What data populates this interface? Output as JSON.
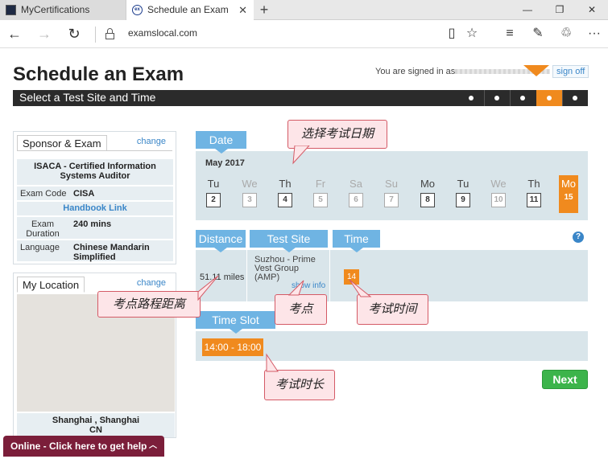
{
  "browser": {
    "tabs": [
      {
        "label": "MyCertifications"
      },
      {
        "label": "Schedule an Exam"
      }
    ],
    "url": "examslocal.com"
  },
  "page": {
    "title": "Schedule an Exam",
    "signed_in_text": "You are signed in as",
    "sign_off": "sign off",
    "step_title": "Select a Test Site and Time",
    "step_count": 5,
    "active_step": 4
  },
  "sponsor": {
    "heading": "Sponsor & Exam",
    "change": "change",
    "exam_name": "ISACA - Certified Information Systems Auditor",
    "exam_code_label": "Exam Code",
    "exam_code": "CISA",
    "handbook": "Handbook Link",
    "duration_label": "Exam Duration",
    "duration": "240 mins",
    "language_label": "Language",
    "language": "Chinese Mandarin Simplified"
  },
  "location": {
    "heading": "My Location",
    "change": "change",
    "city": "Shanghai , Shanghai",
    "country": "CN"
  },
  "date": {
    "label": "Date",
    "month": "May 2017",
    "days": [
      {
        "name": "Tu",
        "num": "2",
        "available": true
      },
      {
        "name": "We",
        "num": "3",
        "available": false
      },
      {
        "name": "Th",
        "num": "4",
        "available": true
      },
      {
        "name": "Fr",
        "num": "5",
        "available": false
      },
      {
        "name": "Sa",
        "num": "6",
        "available": false
      },
      {
        "name": "Su",
        "num": "7",
        "available": false
      },
      {
        "name": "Mo",
        "num": "8",
        "available": true
      },
      {
        "name": "Tu",
        "num": "9",
        "available": true
      },
      {
        "name": "We",
        "num": "10",
        "available": false
      },
      {
        "name": "Th",
        "num": "11",
        "available": true
      },
      {
        "name": "Mo",
        "num": "15",
        "available": true,
        "selected": true
      }
    ]
  },
  "distance": {
    "label": "Distance",
    "value": "51.11 miles"
  },
  "test_site": {
    "label": "Test Site",
    "name": "Suzhou - Prime Vest Group (AMP)",
    "show_info": "show info"
  },
  "time": {
    "label": "Time",
    "value": "14"
  },
  "time_slot": {
    "label": "Time Slot",
    "value": "14:00 - 18:00"
  },
  "next": "Next",
  "help": "?",
  "chat": {
    "label": "Online - Click here to get help"
  },
  "annotations": {
    "date": "选择考试日期",
    "distance": "考点路程距离",
    "site": "考点",
    "time": "考试时间",
    "duration": "考试时长"
  },
  "colors": {
    "accent_orange": "#f08a1e",
    "tab_blue": "#6fb4e3",
    "panel_bg": "#d9e5ea",
    "next_green": "#3cb44b",
    "chat_maroon": "#7b1e3a",
    "callout_bg": "#fde5e8"
  }
}
